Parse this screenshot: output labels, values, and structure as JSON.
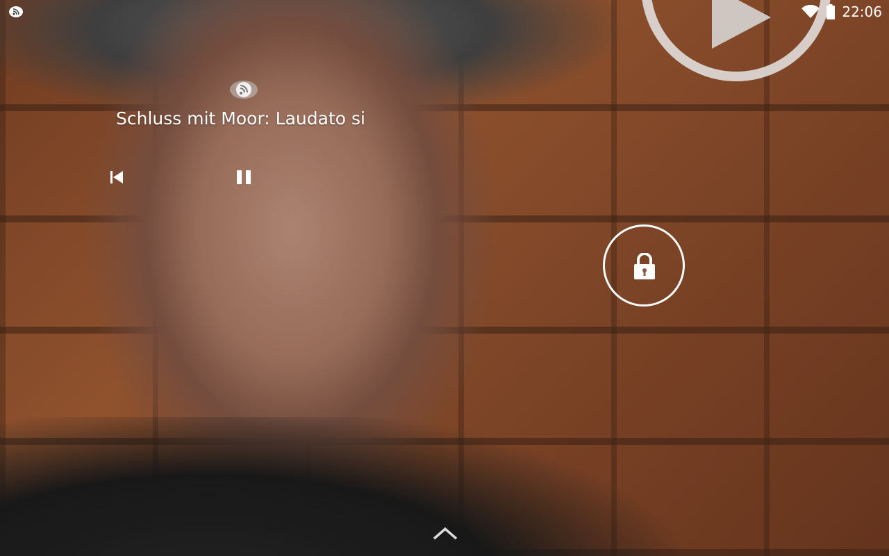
{
  "status_bar": {
    "time": "22:06",
    "left_icon": "cast-notification-icon",
    "wifi_icon": "wifi-icon",
    "battery_icon": "battery-icon"
  },
  "media": {
    "title": "Schluss mit Moor: Laudato si",
    "source_icon": "podcast-cast-icon",
    "prev_icon": "skip-previous-icon",
    "pause_icon": "pause-icon"
  },
  "lockscreen": {
    "lock_icon": "lock-icon",
    "unlock_hint_icon": "chevron-up-icon",
    "play_icon": "play-icon"
  },
  "colors": {
    "foreground": "#ffffff"
  }
}
